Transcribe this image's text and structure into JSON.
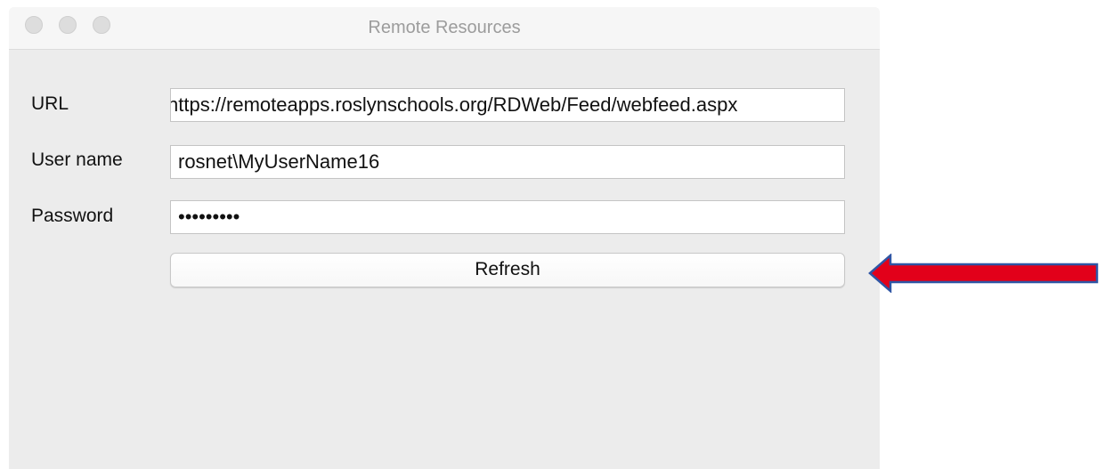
{
  "window": {
    "title": "Remote Resources"
  },
  "form": {
    "url_label": "URL",
    "url_value": "https://remoteapps.roslynschools.org/RDWeb/Feed/webfeed.aspx",
    "username_label": "User name",
    "username_value": "rosnet\\MyUserName16",
    "password_label": "Password",
    "password_mask": "•••••••••",
    "refresh_label": "Refresh"
  },
  "annotation": {
    "arrow_icon": "left-arrow-icon",
    "arrow_color": "#e2001a",
    "arrow_outline_color": "#2f55a4"
  }
}
